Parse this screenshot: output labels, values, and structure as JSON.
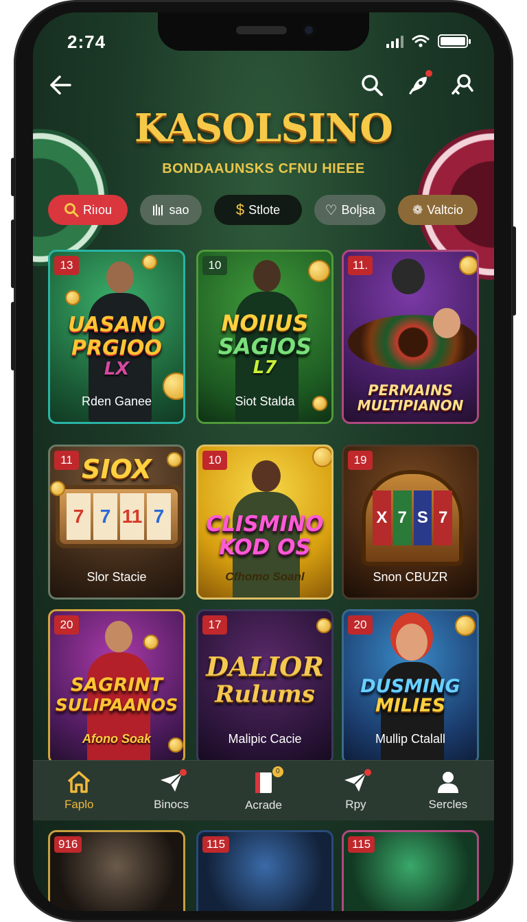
{
  "status": {
    "time": "2:74"
  },
  "app": {
    "brand": "KASOLSINO",
    "tagline": "BONDAAUNSKS CFNU HIEEE",
    "icons": {
      "back": "back-arrow-icon",
      "search": "search-icon",
      "rocket": "rocket-icon",
      "key": "key-search-icon"
    }
  },
  "filters": [
    {
      "label": "Riıou",
      "icon": "search-icon",
      "color": "#d9363e"
    },
    {
      "label": "sao",
      "icon": "bars-icon",
      "color": "#56685a"
    },
    {
      "label": "Stlote",
      "icon": "dollar-icon",
      "color": "#111a14"
    },
    {
      "label": "Boljsa",
      "icon": "heart-icon",
      "color": "#55675b"
    },
    {
      "label": "Valtcio",
      "icon": "gift-icon",
      "color": "#8c6a38"
    }
  ],
  "games": [
    {
      "num": "13",
      "title_lines": [
        "UASANO",
        "PRGIOO",
        "LX"
      ],
      "subtitle": "Rden Ganee",
      "border": "#29b4a6"
    },
    {
      "num": "10",
      "title_lines": [
        "NOIIUS",
        "SAGIOS",
        "L7"
      ],
      "subtitle": "Siot Stalda",
      "border": "#4f9a3a"
    },
    {
      "num": "11.",
      "title_lines": [
        "PERMAINS",
        "MULTIPIANON"
      ],
      "subtitle": "",
      "border": "#b0497f"
    },
    {
      "num": "11",
      "title_lines": [
        "SIOX"
      ],
      "subtitle": "Slor Stacie",
      "border": "#6a7a66"
    },
    {
      "num": "10",
      "title_lines": [
        "CLISMINO",
        "KOD OS"
      ],
      "subtitle": "Cfhomo Soanl",
      "border": "#e0c067"
    },
    {
      "num": "19",
      "title_lines": [],
      "subtitle": "Snon CBUZR",
      "border": "#4a3a2a"
    },
    {
      "num": "20",
      "title_lines": [
        "SAGRINT",
        "SULIPAANOS"
      ],
      "subtitle": "Afono Soak",
      "border": "#d4a33b"
    },
    {
      "num": "17",
      "title_lines": [
        "DALIOR",
        "Rulums"
      ],
      "subtitle": "Malipic Cacie",
      "border": "#3a3a5a"
    },
    {
      "num": "20",
      "title_lines": [
        "DUSMING",
        "MILIES"
      ],
      "subtitle": "Mullip Ctalall",
      "border": "#3a6a8a"
    }
  ],
  "peek_games": [
    {
      "num": "916"
    },
    {
      "num": "115"
    },
    {
      "num": "115"
    }
  ],
  "nav": [
    {
      "label": "Faplo",
      "icon": "home-icon",
      "active": true
    },
    {
      "label": "Binocs",
      "icon": "paper-plane-icon",
      "active": false
    },
    {
      "label": "Acrade",
      "icon": "book-icon",
      "active": false
    },
    {
      "label": "Rpy",
      "icon": "send-icon",
      "active": false
    },
    {
      "label": "Sercles",
      "icon": "user-icon",
      "active": false
    }
  ]
}
